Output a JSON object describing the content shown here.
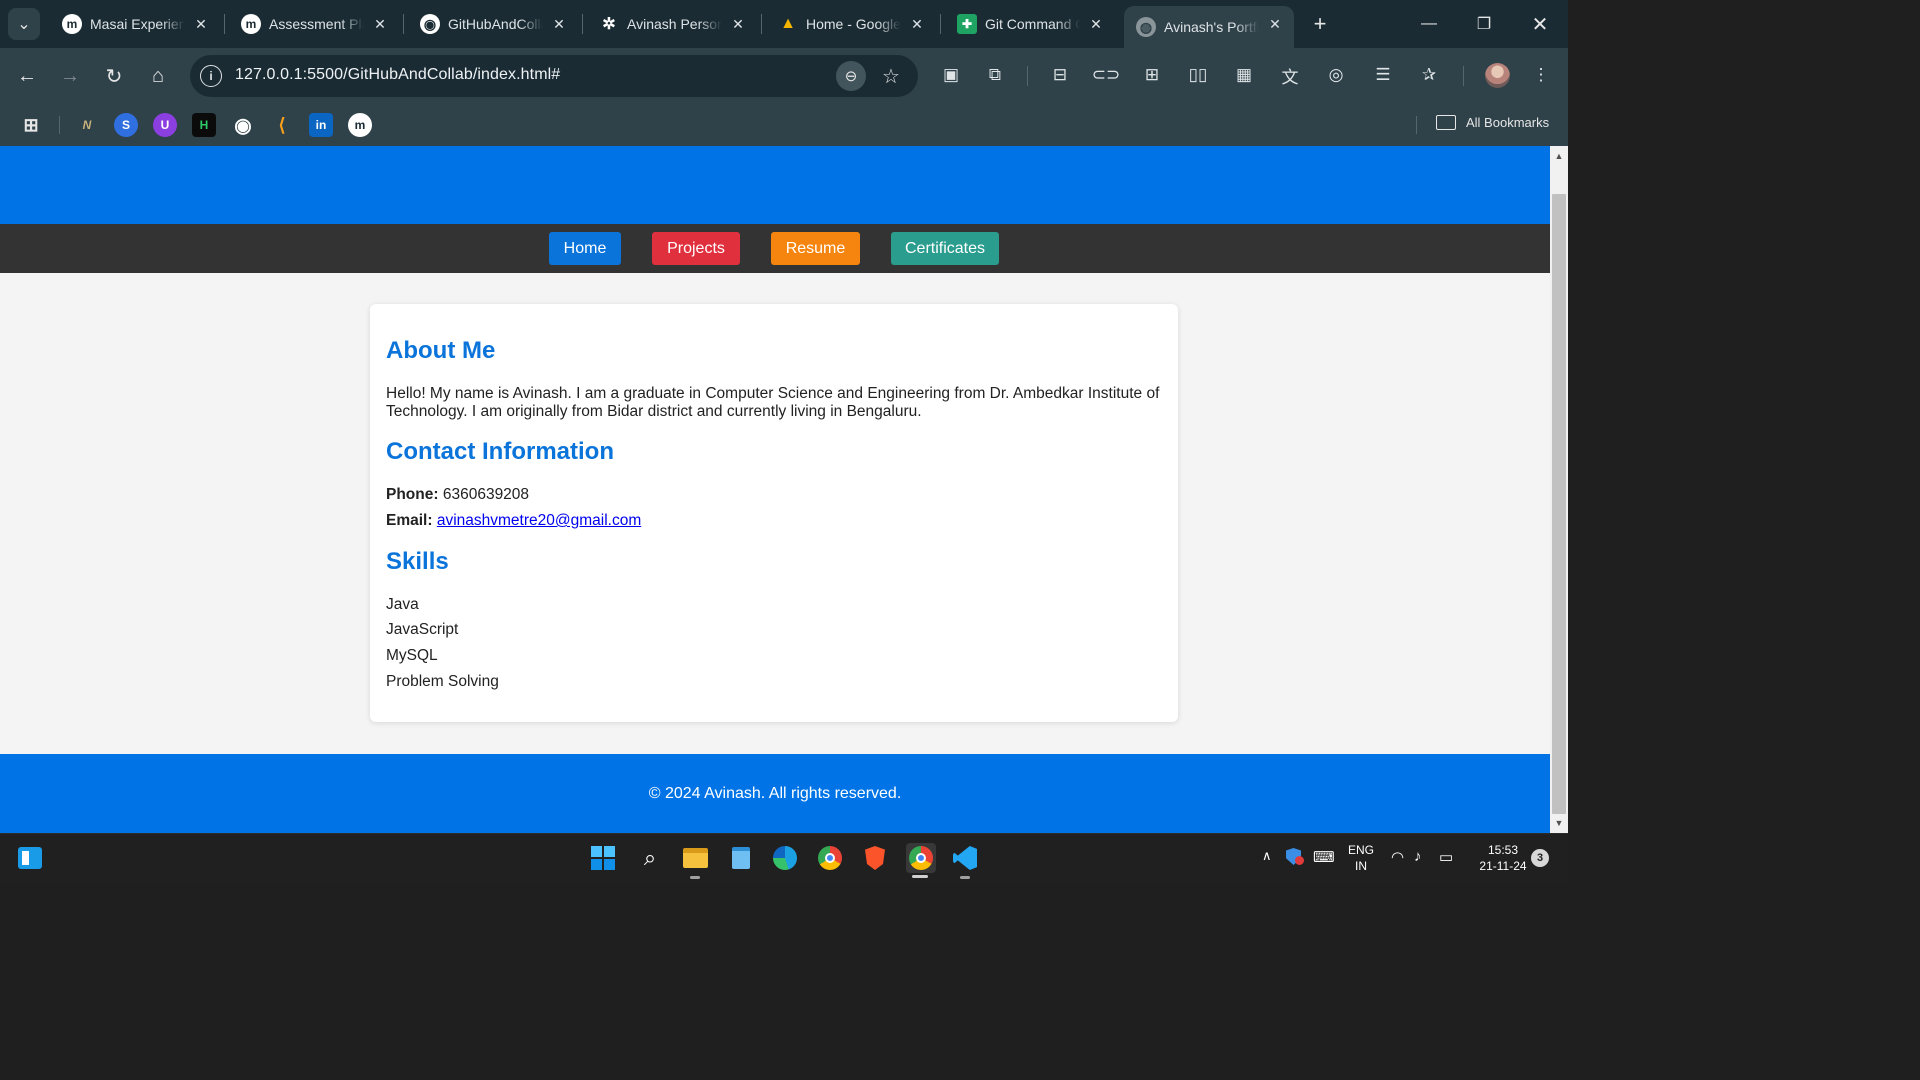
{
  "browser": {
    "tabs": [
      {
        "title": "Masai Experience",
        "favicon": "masai-m-icon",
        "fav_char": "m",
        "fav_bg": "#ffffff",
        "fav_fg": "#1a2b33"
      },
      {
        "title": "Assessment Platform",
        "favicon": "masai-m-icon",
        "fav_char": "m",
        "fav_bg": "#ffffff",
        "fav_fg": "#1a2b33"
      },
      {
        "title": "GitHubAndCollab",
        "favicon": "github-icon",
        "fav_char": "◉",
        "fav_bg": "#1a2b33",
        "fav_fg": "#ffffff"
      },
      {
        "title": "Avinash Personal",
        "favicon": "openai-icon",
        "fav_char": "✲",
        "fav_bg": "#1a2b33",
        "fav_fg": "#ffffff"
      },
      {
        "title": "Home - Google Drive",
        "favicon": "google-drive-icon",
        "fav_char": "▲",
        "fav_bg": "transparent",
        "fav_fg": "#f4b400"
      },
      {
        "title": "Git Command Cheat",
        "favicon": "google-sheets-icon",
        "fav_char": "✚",
        "fav_bg": "#1ea362",
        "fav_fg": "#ffffff"
      },
      {
        "title": "Avinash's Portfolio",
        "favicon": "globe-icon",
        "fav_char": "◍",
        "fav_bg": "transparent",
        "fav_fg": "#c9cfd2"
      }
    ],
    "url": "127.0.0.1:5500/GitHubAndCollab/index.html#",
    "all_bookmarks_label": "All Bookmarks",
    "bookmarks": [
      {
        "name": "bookmark-netlify-icon",
        "char": "N",
        "bg": "transparent",
        "fg": "#c9b27a"
      },
      {
        "name": "bookmark-swiggy-icon",
        "char": "S",
        "bg": "#2f6fe0",
        "fg": "#ffffff"
      },
      {
        "name": "bookmark-unstop-icon",
        "char": "U",
        "bg": "#8c3fe0",
        "fg": "#ffffff"
      },
      {
        "name": "bookmark-hackerrank-icon",
        "char": "H",
        "bg": "#0b0b0b",
        "fg": "#2ec866"
      },
      {
        "name": "bookmark-github-icon",
        "char": "◉",
        "bg": "transparent",
        "fg": "#ffffff"
      },
      {
        "name": "bookmark-leetcode-icon",
        "char": "⟨",
        "bg": "transparent",
        "fg": "#f89f1b"
      },
      {
        "name": "bookmark-linkedin-icon",
        "char": "in",
        "bg": "#0a66c2",
        "fg": "#ffffff"
      },
      {
        "name": "bookmark-masai-icon",
        "char": "m",
        "bg": "#ffffff",
        "fg": "#1a2b33"
      }
    ]
  },
  "page": {
    "nav": [
      {
        "label": "Home",
        "color": "#0a74da"
      },
      {
        "label": "Projects",
        "color": "#e0303e"
      },
      {
        "label": "Resume",
        "color": "#f6850f"
      },
      {
        "label": "Certificates",
        "color": "#2a9d8f"
      }
    ],
    "about_heading": "About Me",
    "about_text": "Hello! My name is Avinash. I am a graduate in Computer Science and Engineering from Dr. Ambedkar Institute of Technology. I am originally from Bidar district and currently living in Bengaluru.",
    "contact_heading": "Contact Information",
    "phone_label": "Phone:",
    "phone_value": "6360639208",
    "email_label": "Email:",
    "email_value": "avinashvmetre20@gmail.com",
    "skills_heading": "Skills",
    "skills": [
      "Java",
      "JavaScript",
      "MySQL",
      "Problem Solving"
    ],
    "footer_text": "© 2024 Avinash. All rights reserved."
  },
  "taskbar": {
    "language_line1": "ENG",
    "language_line2": "IN",
    "time": "15:53",
    "date": "21-11-24",
    "notification_count": "3"
  },
  "colors": {
    "accent_blue": "#0074e6",
    "nav_strip": "#333333"
  }
}
